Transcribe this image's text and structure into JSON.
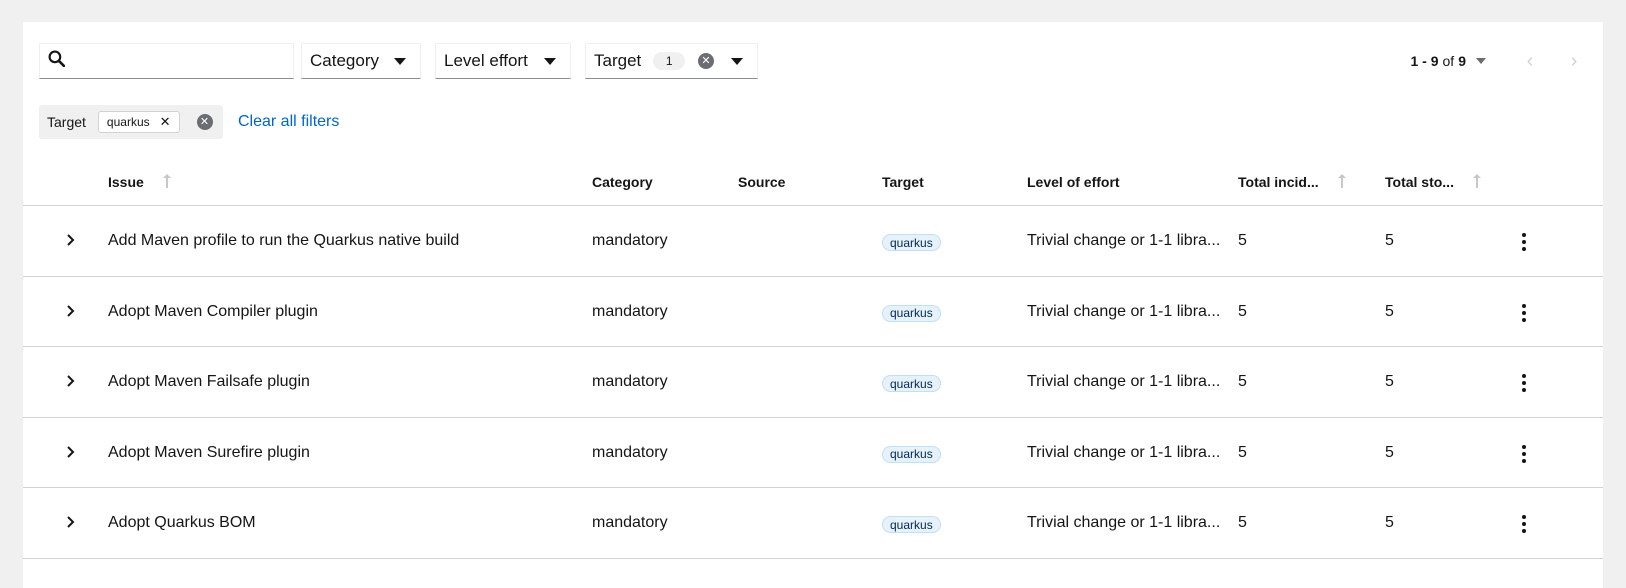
{
  "toolbar": {
    "search": {
      "value": "",
      "placeholder": ""
    },
    "filters": [
      {
        "label": "Category"
      },
      {
        "label": "Level effort"
      },
      {
        "label": "Target",
        "count": "1"
      }
    ]
  },
  "pagination": {
    "range": "1 - 9",
    "of": "of",
    "total": "9"
  },
  "chip_group": {
    "category": "Target",
    "chips": [
      "quarkus"
    ],
    "clear_all": "Clear all filters"
  },
  "table": {
    "columns": [
      "Issue",
      "Category",
      "Source",
      "Target",
      "Level of effort",
      "Total incid...",
      "Total sto..."
    ],
    "rows": [
      {
        "issue": "Add Maven profile to run the Quarkus native build",
        "category": "mandatory",
        "source": "",
        "target": "quarkus",
        "effort": "Trivial change or 1-1 libra...",
        "incidents": "5",
        "story_points": "5"
      },
      {
        "issue": "Adopt Maven Compiler plugin",
        "category": "mandatory",
        "source": "",
        "target": "quarkus",
        "effort": "Trivial change or 1-1 libra...",
        "incidents": "5",
        "story_points": "5"
      },
      {
        "issue": "Adopt Maven Failsafe plugin",
        "category": "mandatory",
        "source": "",
        "target": "quarkus",
        "effort": "Trivial change or 1-1 libra...",
        "incidents": "5",
        "story_points": "5"
      },
      {
        "issue": "Adopt Maven Surefire plugin",
        "category": "mandatory",
        "source": "",
        "target": "quarkus",
        "effort": "Trivial change or 1-1 libra...",
        "incidents": "5",
        "story_points": "5"
      },
      {
        "issue": "Adopt Quarkus BOM",
        "category": "mandatory",
        "source": "",
        "target": "quarkus",
        "effort": "Trivial change or 1-1 libra...",
        "incidents": "5",
        "story_points": "5"
      }
    ]
  },
  "icons": {
    "search": "search-icon",
    "caret": "caret-down-icon",
    "clear": "times-circle-icon",
    "chip_close": "times-icon",
    "prev": "angle-left-icon",
    "next": "angle-right-icon",
    "expand": "angle-right-icon",
    "kebab": "ellipsis-v-icon",
    "sort": "sort-icon"
  },
  "colors": {
    "link": "#0066cc",
    "tag_bg": "#e7f1fa",
    "tag_border": "#bee1f4",
    "border": "#d2d2d2",
    "page_bg": "#f0f0f0"
  }
}
